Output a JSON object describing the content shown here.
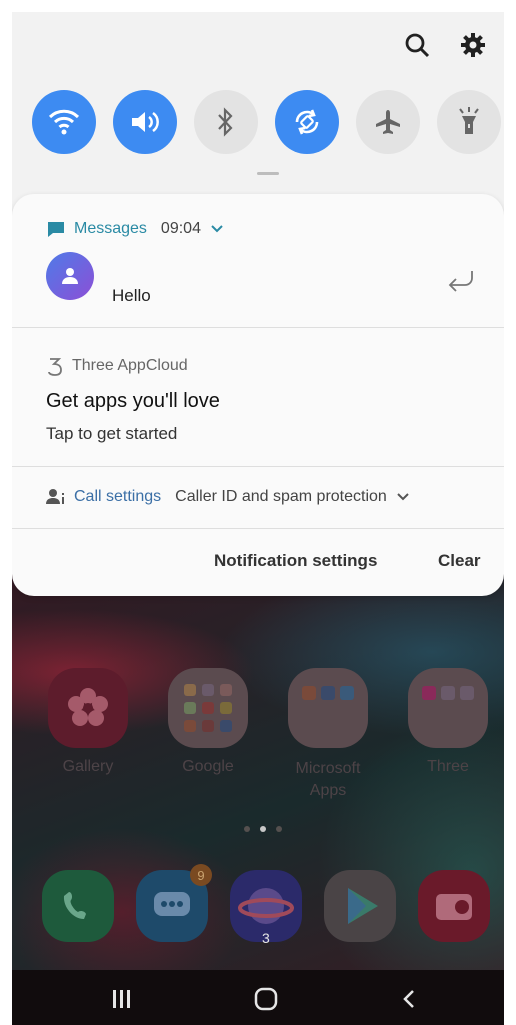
{
  "quick_settings": {
    "tiles": [
      {
        "id": "wifi",
        "state": "on",
        "icon": "wifi-icon"
      },
      {
        "id": "sound",
        "state": "on",
        "icon": "volume-icon"
      },
      {
        "id": "bluetooth",
        "state": "off",
        "icon": "bluetooth-icon"
      },
      {
        "id": "auto-rotate",
        "state": "on",
        "icon": "rotate-icon"
      },
      {
        "id": "airplane",
        "state": "off",
        "icon": "airplane-icon"
      },
      {
        "id": "flashlight",
        "state": "off",
        "icon": "flashlight-icon"
      }
    ],
    "accent_color": "#3d8bf2"
  },
  "notifications": {
    "messages": {
      "app": "Messages",
      "time": "09:04",
      "text": "Hello"
    },
    "appcloud": {
      "app": "Three AppCloud",
      "title": "Get apps you'll love",
      "subtitle": "Tap to get started"
    },
    "call": {
      "app": "Call settings",
      "text": "Caller ID and spam protection"
    },
    "footer": {
      "settings_label": "Notification settings",
      "clear_label": "Clear"
    }
  },
  "home": {
    "apps": [
      {
        "name": "gallery",
        "label": "Gallery"
      },
      {
        "name": "google",
        "label": "Google"
      },
      {
        "name": "microsoft",
        "label": "Microsoft\nApps"
      },
      {
        "name": "three",
        "label": "Three"
      }
    ],
    "dock": [
      {
        "name": "phone"
      },
      {
        "name": "messages",
        "badge": "9"
      },
      {
        "name": "internet"
      },
      {
        "name": "play-store"
      },
      {
        "name": "camera"
      }
    ],
    "count_text": "3"
  }
}
